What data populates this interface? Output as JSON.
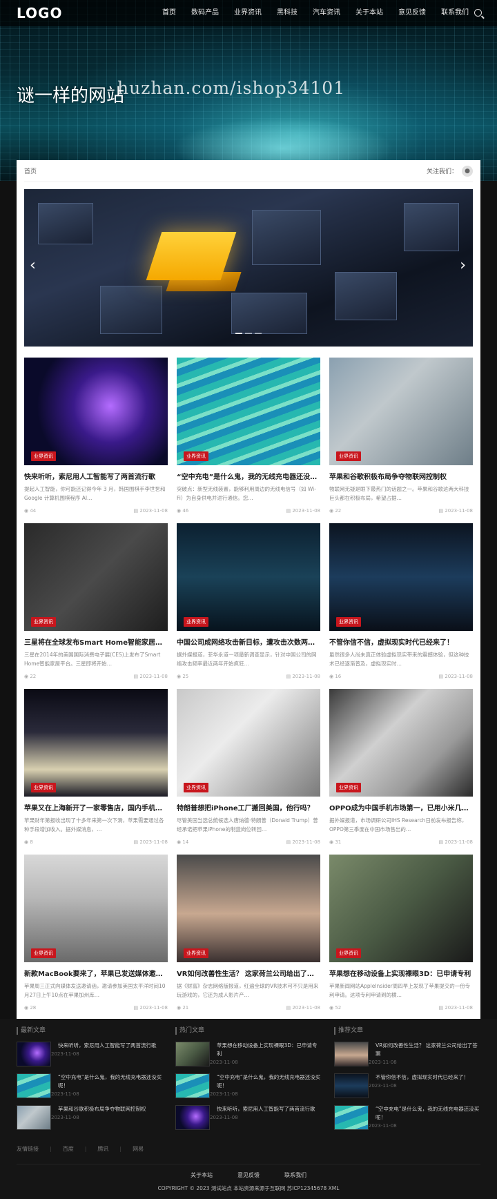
{
  "header": {
    "logo": "LOGO",
    "nav": [
      "首页",
      "数码产品",
      "业界资讯",
      "黑科技",
      "汽车资讯",
      "关于本站",
      "意见反馈",
      "联系我们"
    ]
  },
  "hero": {
    "title": "谜一样的网站",
    "watermark": "huzhan.com/ishop34101"
  },
  "breadcrumb": "首页",
  "follow_label": "关注我们：",
  "articles": [
    {
      "title": "快来听听，索尼用人工智能写了两首流行歌",
      "desc": "提起人工智能，你可能还记得今年 3 月，韩国围棋手李世乭和 Google 计算机围棋程序 AI…",
      "tag": "业界资讯",
      "views": "44",
      "date": "2023-11-08"
    },
    {
      "title": "“空中充电”是什么鬼，我的无线充电器还没买呢！",
      "desc": "突破点：新型无线装置，能够利用周边的无线电信号（如 Wi-Fi）为自身供电并进行通信。您…",
      "tag": "业界资讯",
      "views": "46",
      "date": "2023-11-08"
    },
    {
      "title": "苹果和谷歌积极布局争夺物联网控制权",
      "desc": "物联网无疑是眼下最热门的话题之一。苹果和谷歌这两大科技巨头都在积极布局，希望占据…",
      "tag": "业界资讯",
      "views": "22",
      "date": "2023-11-08"
    },
    {
      "title": "三星将在全球发布Smart Home智能家居平台",
      "desc": "三星在2014年的美国国际消费电子展(CES)上发布了Smart Home智能家居平台。三星即将开始…",
      "tag": "业界资讯",
      "views": "22",
      "date": "2023-11-08"
    },
    {
      "title": "中国公司成网络攻击新目标，遭攻击次数两年暴增…",
      "desc": "据外媒报道，菲华永道一项最新调查显示，针对中国公司的网络攻击频率最近两年开始疯狂…",
      "tag": "业界资讯",
      "views": "25",
      "date": "2023-11-08"
    },
    {
      "title": "不管你信不信，虚拟现实时代已经来了！",
      "desc": "虽然很多人尚未真正体验虚拟现实带来的震撼体验，但这种技术已经逐渐普及，虚拟现实时…",
      "tag": "业界资讯",
      "views": "16",
      "date": "2023-11-08"
    },
    {
      "title": "苹果又在上海新开了一家零售店，国内手机线下争…",
      "desc": "苹果财年第报收出现了十多年来第一次下滑，苹果需要通过各种手段增加收入。据外媒消息，…",
      "tag": "业界资讯",
      "views": "8",
      "date": "2023-11-08"
    },
    {
      "title": "特朗普想把iPhone工厂搬回美国，他行吗？",
      "desc": "尽管美国当选总统候选人唐纳德·特朗普（Donald Trump）曾经承诺把苹果iPhone的制造岗位转回…",
      "tag": "业界资讯",
      "views": "14",
      "date": "2023-11-08"
    },
    {
      "title": "OPPO成为中国手机市场第一，已用小米几条街",
      "desc": "据外媒报道，市场调研公司IHS Research日前发布报告称，OPPO第三季度在中国市场售出的…",
      "tag": "业界资讯",
      "views": "31",
      "date": "2023-11-08"
    },
    {
      "title": "新款MacBook要来了，苹果已发送媒体邀请函",
      "desc": "苹果周三正式向媒体发送邀请函，邀请参加美国太平洋时间10月27日上午10点在苹果加州库…",
      "tag": "业界资讯",
      "views": "28",
      "date": "2023-11-08"
    },
    {
      "title": "VR如何改善性生活？ 这家荷兰公司给出了答案",
      "desc": "据《财富》杂志网络版报道，红遍全球的VR技术可不只是用来玩游戏的，它还为成人影片产…",
      "tag": "业界资讯",
      "views": "21",
      "date": "2023-11-08"
    },
    {
      "title": "苹果想在移动设备上实现裸眼3D：已申请专利",
      "desc": "苹果新闻网站AppleInsider周四早上发现了苹果提交的一份专利申请。这项专利申请到的横…",
      "tag": "业界资讯",
      "views": "52",
      "date": "2023-11-08"
    }
  ],
  "footer": {
    "cols": [
      {
        "head": "最新文章",
        "items": [
          {
            "title": "快来听听，索尼用人工智能写了两首流行歌",
            "date": "2023-11-08"
          },
          {
            "title": "“空中充电”是什么鬼，我的无线充电器还没买呢！",
            "date": "2023-11-08"
          },
          {
            "title": "苹果和谷歌积极布局争夺物联网控制权",
            "date": "2023-11-08"
          }
        ]
      },
      {
        "head": "热门文章",
        "items": [
          {
            "title": "苹果想在移动设备上实现裸眼3D：已申请专利",
            "date": "2023-11-08"
          },
          {
            "title": "“空中充电”是什么鬼，我的无线充电器还没买呢！",
            "date": "2023-11-08"
          },
          {
            "title": "快来听听，索尼用人工智能写了两首流行歌",
            "date": "2023-11-08"
          }
        ]
      },
      {
        "head": "推荐文章",
        "items": [
          {
            "title": "VR如何改善性生活？ 这家荷兰公司给出了答案",
            "date": "2023-11-08"
          },
          {
            "title": "不管你信不信，虚拟现实时代已经来了！",
            "date": "2023-11-08"
          },
          {
            "title": "“空中充电”是什么鬼，我的无线充电器还没买呢！",
            "date": "2023-11-08"
          }
        ]
      }
    ],
    "links_label": "友情链接",
    "links": [
      "百度",
      "腾讯",
      "网易"
    ],
    "bottom_nav": [
      "关于本站",
      "意见反馈",
      "联系我们"
    ],
    "copyright": "COPYRIGHT © 2023 测试站点 本站资源来源于互联网 苏ICP12345678 XML"
  }
}
